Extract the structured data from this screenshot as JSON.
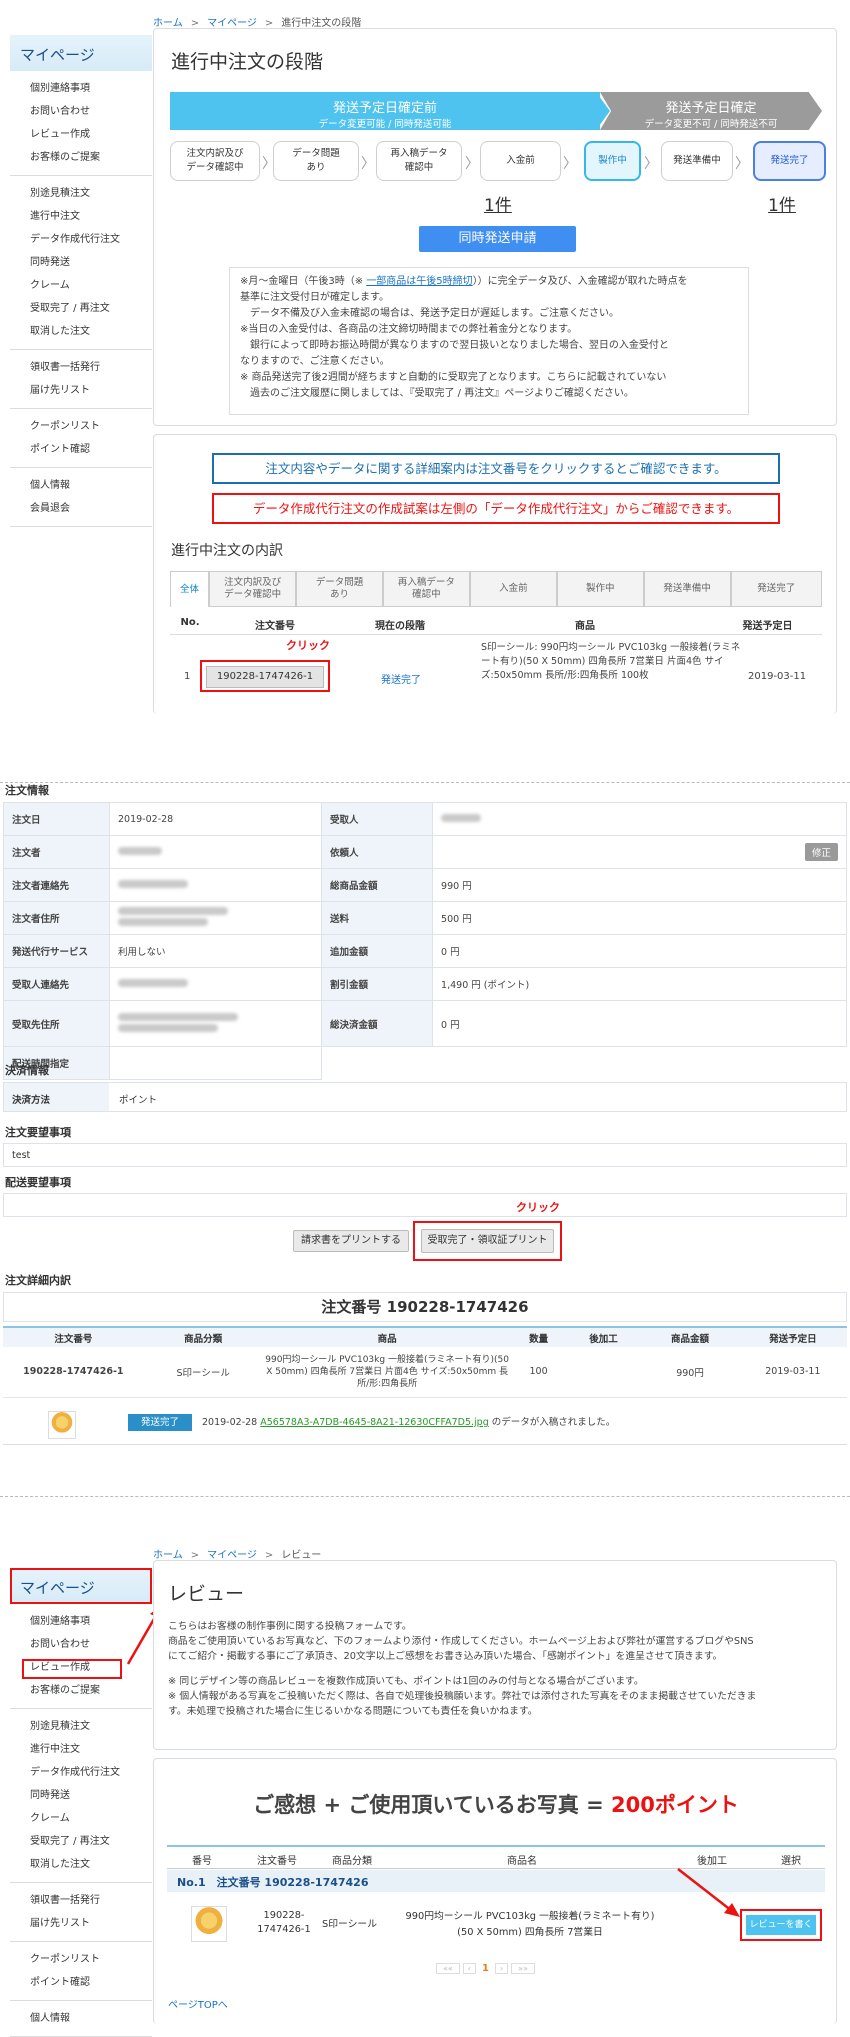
{
  "s1": {
    "breadcrumb": [
      "ホーム",
      "マイページ",
      "進行中注文の段階"
    ],
    "sidebar": {
      "title": "マイページ",
      "groups": [
        [
          "個別連絡事項",
          "お問い合わせ",
          "レビュー作成",
          "お客様のご提案"
        ],
        [
          "別途見積注文",
          "進行中注文",
          "データ作成代行注文",
          "同時発送",
          "クレーム",
          "受取完了 / 再注文",
          "取消した注文"
        ],
        [
          "領収書一括発行",
          "届け先リスト"
        ],
        [
          "クーポンリスト",
          "ポイント確認"
        ],
        [
          "個人情報",
          "会員退会"
        ]
      ]
    },
    "page_title": "進行中注文の段階",
    "band_left": {
      "title": "発送予定日確定前",
      "sub": "データ変更可能 / 同時発送可能"
    },
    "band_right": {
      "title": "発送予定日確定",
      "sub": "データ変更不可 / 同時発送不可"
    },
    "steps": [
      "注文内訳及び\nデータ確認中",
      "データ問題\nあり",
      "再入稿データ\n確認中",
      "入金前",
      "製作中",
      "発送準備中",
      "発送完了"
    ],
    "count_a": "1件",
    "count_b": "1件",
    "simul_btn": "同時発送申請",
    "notice": [
      "※月～金曜日（午後3時（※",
      "一部商品は午後5時締切",
      "））に完全データ及び、入金確認が取れた時点を",
      "基準に注文受付日が確定します。",
      "　データ不備及び入金未確認の場合は、発送予定日が遅延します。ご注意ください。",
      "※当日の入金受付は、各商品の注文締切時間までの弊社着金分となります。",
      "　銀行によって即時お振込時間が異なりますので翌日扱いとなりました場合、翌日の入金受付と",
      "なりますので、ご注意ください。",
      "※ 商品発送完了後2週間が経ちますと自動的に受取完了となります。こちらに記載されていない",
      "　過去のご注文履歴に関しましては、『受取完了 / 再注文』ページよりご確認ください。"
    ],
    "info_blue": "注文内容やデータに関する詳細案内は注文番号をクリックするとご確認できます。",
    "info_red": "データ作成代行注文の作成試案は左側の「データ作成代行注文」からご確認できます。",
    "list_title": "進行中注文の内訳",
    "tabs": [
      "全体",
      "注文内訳及び\nデータ確認中",
      "データ問題\nあり",
      "再入稿データ\n確認中",
      "入金前",
      "製作中",
      "発送準備中",
      "発送完了"
    ],
    "cols": [
      "No.",
      "注文番号",
      "現在の段階",
      "商品",
      "発送予定日"
    ],
    "click": "クリック",
    "row": {
      "no": "1",
      "order": "190228-1747426-1",
      "stage": "発送完了",
      "product": "S印ーシール: 990円均ーシール PVC103kg 一般接着(ラミネート有り)(50 X 50mm) 四角長所 7営業日 片面4色 サイズ:50x50mm 長所/形:四角長所 100枚",
      "date": "2019-03-11"
    }
  },
  "s2": {
    "order_info": "注文情報",
    "rows": [
      [
        "注文日",
        "2019-02-28",
        "受取人",
        ""
      ],
      [
        "注文者",
        "",
        "依頼人",
        ""
      ],
      [
        "注文者連絡先",
        "",
        "総商品金額",
        "990 円"
      ],
      [
        "注文者住所",
        "",
        "送料",
        "500 円"
      ],
      [
        "発送代行サービス",
        "利用しない",
        "追加金額",
        "0 円"
      ],
      [
        "受取人連絡先",
        "",
        "割引金額",
        "1,490 円 (ポイント)"
      ],
      [
        "受取先住所",
        "",
        "総決済金額",
        "0 円"
      ],
      [
        "配送時間指定",
        "",
        "",
        ""
      ]
    ],
    "fix": "修正",
    "pay_title": "決済情報",
    "pay_key": "決済方法",
    "pay_val": "ポイント",
    "req_title": "注文要望事項",
    "req_val": "test",
    "ship_title": "配送要望事項",
    "click": "クリック",
    "btn_invoice": "請求書をプリントする",
    "btn_receipt": "受取完了・領収証プリント",
    "detail_title": "注文詳細内訳",
    "order_no": "注文番号 190228-1747426",
    "cols": [
      "注文番号",
      "商品分類",
      "商品",
      "数量",
      "後加工",
      "商品金額",
      "発送予定日"
    ],
    "row": {
      "order": "190228-1747426-1",
      "cat": "S印ーシール",
      "product": "990円均ーシール PVC103kg 一般接着(ラミネート有り)(50 X 50mm) 四角長所 7営業日 片面4色 サイズ:50x50mm 長所/形:四角長所",
      "qty": "100",
      "post": "",
      "price": "990円",
      "date": "2019-03-11"
    },
    "status": "発送完了",
    "file_date": "2019-02-28",
    "file_link": "A56578A3-A7DB-4645-8A21-12630CFFA7D5.jpg",
    "file_msg": "のデータが入稿されました。"
  },
  "s3": {
    "breadcrumb": [
      "ホーム",
      "マイページ",
      "レビュー"
    ],
    "sidebar": {
      "title": "マイページ",
      "groups": [
        [
          "個別連絡事項",
          "お問い合わせ",
          "レビュー作成",
          "お客様のご提案"
        ],
        [
          "別途見積注文",
          "進行中注文",
          "データ作成代行注文",
          "同時発送",
          "クレーム",
          "受取完了 / 再注文",
          "取消した注文"
        ],
        [
          "領収書一括発行",
          "届け先リスト"
        ],
        [
          "クーポンリスト",
          "ポイント確認"
        ],
        [
          "個人情報"
        ]
      ]
    },
    "title": "レビュー",
    "desc": [
      "こちらはお客様の制作事例に関する投稿フォームです。",
      "商品をご使用頂いているお写真など、下のフォームより添付・作成してください。ホームページ上および弊社が運営するブログやSNS",
      "にてご紹介・掲載する事にご了承頂き、20文字以上ご感想をお書き込み頂いた場合、「感謝ポイント」を進呈させて頂きます。",
      "",
      "※ 同じデザイン等の商品レビューを複数作成頂いても、ポイントは1回のみの付与となる場合がございます。",
      "※ 個人情報がある写真をご投稿いただく際は、各自で処理後投稿願います。弊社では添付された写真をそのまま掲載させていただきま",
      "す。未処理で投稿された場合に生じるいかなる問題についても責任を負いかねます。"
    ],
    "promo_a": "ご感想 + ご使用頂いているお写真 = ",
    "promo_b": "200ポイント",
    "cols": [
      "番号",
      "注文番号",
      "商品分類",
      "商品名",
      "後加工",
      "選択"
    ],
    "group_row": "No.1　注文番号 190228-1747426",
    "row": {
      "order": "190228-1747426-1",
      "cat": "S印ーシール",
      "name": "990円均ーシール PVC103kg 一般接着(ラミネート有り)(50 X 50mm) 四角長所 7営業日",
      "post": ""
    },
    "review_btn": "レビューを書く",
    "page": "1",
    "top_link": "ページTOPへ"
  },
  "colors": {
    "accent": "#4fc3f0",
    "blue_btn": "#3f8ef2",
    "red": "#e11111",
    "link": "#1a73c8"
  }
}
